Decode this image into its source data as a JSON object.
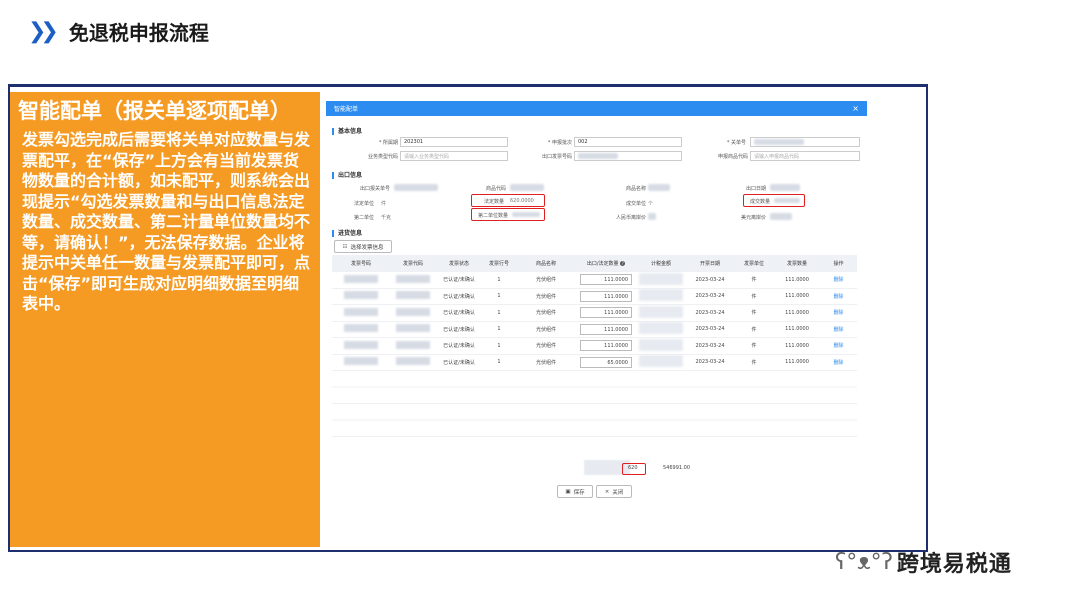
{
  "header": {
    "title": "免退税申报流程"
  },
  "left_panel": {
    "heading": "智能配单（报关单逐项配单）",
    "description": "发票勾选完成后需要将关单对应数量与发票配平，在“保存”上方会有当前发票货物数量的合计额，如未配平，则系统会出现提示“勾选发票数量和与出口信息法定数量、成交数量、第二计量单位数量均不等，请确认！”，无法保存数据。企业将提示中关单任一数量与发票配平即可，点击“保存”即可生成对应明细数据至明细表中。"
  },
  "dialog": {
    "title": "智能配单",
    "close": "×",
    "basic_section": "基本信息",
    "basic": {
      "period_label": "* 所属期",
      "period_value": "202301",
      "batch_label": "* 申报批次",
      "batch_value": "002",
      "serial_label": "* 关单号",
      "customs_code_label": "业务类型代码",
      "customs_code_ph": "请输入业务类型代码",
      "export_no_label": "出口发票号码",
      "goods_code_label": "申报商品代码",
      "goods_code_ph": "请输入申报商品代码"
    },
    "export_section": "出口信息",
    "export": {
      "customs_no_label": "出口报关单号",
      "goods_code_label": "商品代码",
      "goods_name_label": "商品名称",
      "export_date_label": "出口日期",
      "legal_unit_label": "法定单位",
      "legal_unit_value": "件",
      "legal_qty_label": "法定数量",
      "legal_qty_value": "620.0000",
      "deal_unit_label": "成交单位",
      "deal_unit_value": "个",
      "deal_qty_label": "成交数量",
      "second_unit_label": "第二单位",
      "second_unit_value": "千克",
      "second_qty_label": "第二单位数量",
      "fob_label": "人民币离岸价",
      "amount_label": "美元离岸价"
    },
    "purchase_section": "进货信息",
    "select_invoice_btn": "选择发票信息",
    "table": {
      "headers": [
        "发票号码",
        "发票代码",
        "发票状态",
        "发票行号",
        "商品名称",
        "出口/法定数量",
        "计税金额",
        "开票日期",
        "发票单位",
        "发票数量",
        "操作"
      ],
      "rows": [
        {
          "status": "已认证/未确认",
          "line": "1",
          "name": "光伏组件",
          "qty": "111.0000",
          "date": "2023-03-24",
          "unit": "件",
          "invqty": "111.0000",
          "op": "删除"
        },
        {
          "status": "已认证/未确认",
          "line": "1",
          "name": "光伏组件",
          "qty": "111.0000",
          "date": "2023-03-24",
          "unit": "件",
          "invqty": "111.0000",
          "op": "删除"
        },
        {
          "status": "已认证/未确认",
          "line": "1",
          "name": "光伏组件",
          "qty": "111.0000",
          "date": "2023-03-24",
          "unit": "件",
          "invqty": "111.0000",
          "op": "删除"
        },
        {
          "status": "已认证/未确认",
          "line": "1",
          "name": "光伏组件",
          "qty": "111.0000",
          "date": "2023-03-24",
          "unit": "件",
          "invqty": "111.0000",
          "op": "删除"
        },
        {
          "status": "已认证/未确认",
          "line": "1",
          "name": "光伏组件",
          "qty": "111.0000",
          "date": "2023-03-24",
          "unit": "件",
          "invqty": "111.0000",
          "op": "删除"
        },
        {
          "status": "已认证/未确认",
          "line": "1",
          "name": "光伏组件",
          "qty": "65.0000",
          "date": "2023-03-24",
          "unit": "件",
          "invqty": "111.0000",
          "op": "删除"
        }
      ]
    },
    "totals": {
      "qty": "620",
      "amount": "546991.00"
    },
    "save_btn": "保存",
    "close_btn": "关闭"
  },
  "watermark": "跨境易税通"
}
